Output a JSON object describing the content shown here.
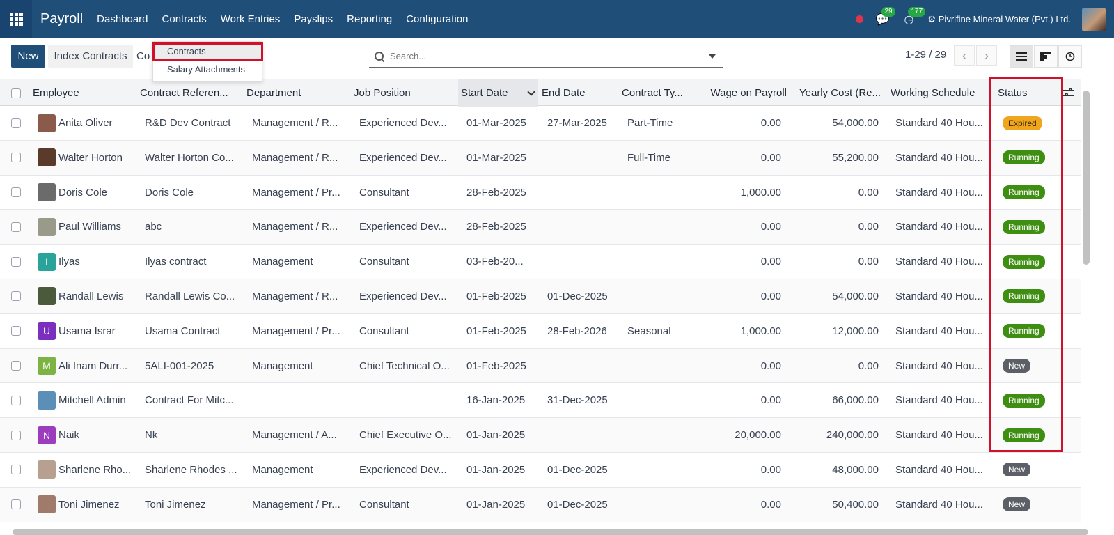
{
  "navbar": {
    "brand": "Payroll",
    "menu": [
      "Dashboard",
      "Contracts",
      "Work Entries",
      "Payslips",
      "Reporting",
      "Configuration"
    ],
    "messages_count": "29",
    "activities_count": "177",
    "company": "Pivrifine Mineral Water (Pvt.) Ltd."
  },
  "control": {
    "new_label": "New",
    "index_label": "Index Contracts",
    "breadcrumb": "Co",
    "dropdown": [
      "Contracts",
      "Salary Attachments"
    ],
    "search_placeholder": "Search...",
    "pager": "1-29 / 29"
  },
  "columns": [
    "Employee",
    "Contract Referen...",
    "Department",
    "Job Position",
    "Start Date",
    "End Date",
    "Contract Ty...",
    "Wage on Payroll",
    "Yearly Cost (Re...",
    "Working Schedule",
    "Status"
  ],
  "rows": [
    {
      "employee": "Anita Oliver",
      "avatar_color": "#8a5a4a",
      "reference": "R&D Dev Contract",
      "department": "Management / R...",
      "job": "Experienced Dev...",
      "start": "01-Mar-2025",
      "end": "27-Mar-2025",
      "type": "Part-Time",
      "wage": "0.00",
      "cost": "54,000.00",
      "schedule": "Standard 40 Hou...",
      "status": "Expired"
    },
    {
      "employee": "Walter Horton",
      "avatar_color": "#5a3a2a",
      "reference": "Walter Horton Co...",
      "department": "Management / R...",
      "job": "Experienced Dev...",
      "start": "01-Mar-2025",
      "end": "",
      "type": "Full-Time",
      "wage": "0.00",
      "cost": "55,200.00",
      "schedule": "Standard 40 Hou...",
      "status": "Running"
    },
    {
      "employee": "Doris Cole",
      "avatar_color": "#6b6b6b",
      "reference": "Doris Cole",
      "department": "Management / Pr...",
      "job": "Consultant",
      "start": "28-Feb-2025",
      "end": "",
      "type": "",
      "wage": "1,000.00",
      "cost": "0.00",
      "schedule": "Standard 40 Hou...",
      "status": "Running"
    },
    {
      "employee": "Paul Williams",
      "avatar_color": "#9a9a8a",
      "reference": "abc",
      "department": "Management / R...",
      "job": "Experienced Dev...",
      "start": "28-Feb-2025",
      "end": "",
      "type": "",
      "wage": "0.00",
      "cost": "0.00",
      "schedule": "Standard 40 Hou...",
      "status": "Running"
    },
    {
      "employee": "Ilyas",
      "avatar_letter": "I",
      "avatar_color": "#2aa39a",
      "reference": "Ilyas contract",
      "department": "Management",
      "job": "Consultant",
      "start": "03-Feb-20...",
      "end": "",
      "type": "",
      "wage": "0.00",
      "cost": "0.00",
      "schedule": "Standard 40 Hou...",
      "status": "Running"
    },
    {
      "employee": "Randall Lewis",
      "avatar_color": "#4a5a3a",
      "reference": "Randall Lewis Co...",
      "department": "Management / R...",
      "job": "Experienced Dev...",
      "start": "01-Feb-2025",
      "end": "01-Dec-2025",
      "type": "",
      "wage": "0.00",
      "cost": "54,000.00",
      "schedule": "Standard 40 Hou...",
      "status": "Running"
    },
    {
      "employee": "Usama Israr",
      "avatar_letter": "U",
      "avatar_color": "#7b2fbe",
      "reference": "Usama Contract",
      "department": "Management / Pr...",
      "job": "Consultant",
      "start": "01-Feb-2025",
      "end": "28-Feb-2026",
      "type": "Seasonal",
      "wage": "1,000.00",
      "cost": "12,000.00",
      "schedule": "Standard 40 Hou...",
      "status": "Running"
    },
    {
      "employee": "Ali Inam Durr...",
      "avatar_letter": "M",
      "avatar_color": "#7cb342",
      "reference": "5ALI-001-2025",
      "department": "Management",
      "job": "Chief Technical O...",
      "start": "01-Feb-2025",
      "end": "",
      "type": "",
      "wage": "0.00",
      "cost": "0.00",
      "schedule": "Standard 40 Hou...",
      "status": "New"
    },
    {
      "employee": "Mitchell Admin",
      "avatar_color": "#5b8fb8",
      "reference": "Contract For Mitc...",
      "department": "",
      "job": "",
      "start": "16-Jan-2025",
      "end": "31-Dec-2025",
      "type": "",
      "wage": "0.00",
      "cost": "66,000.00",
      "schedule": "Standard 40 Hou...",
      "status": "Running"
    },
    {
      "employee": "Naik",
      "avatar_letter": "N",
      "avatar_color": "#9c3dbe",
      "reference": "Nk",
      "department": "Management / A...",
      "job": "Chief Executive O...",
      "start": "01-Jan-2025",
      "end": "",
      "type": "",
      "wage": "20,000.00",
      "cost": "240,000.00",
      "schedule": "Standard 40 Hou...",
      "status": "Running"
    },
    {
      "employee": "Sharlene Rho...",
      "avatar_color": "#b8a090",
      "reference": "Sharlene Rhodes ...",
      "department": "Management",
      "job": "Experienced Dev...",
      "start": "01-Jan-2025",
      "end": "01-Dec-2025",
      "type": "",
      "wage": "0.00",
      "cost": "48,000.00",
      "schedule": "Standard 40 Hou...",
      "status": "New"
    },
    {
      "employee": "Toni Jimenez",
      "avatar_color": "#a07a6a",
      "reference": "Toni Jimenez",
      "department": "Management / Pr...",
      "job": "Consultant",
      "start": "01-Jan-2025",
      "end": "01-Dec-2025",
      "type": "",
      "wage": "0.00",
      "cost": "50,400.00",
      "schedule": "Standard 40 Hou...",
      "status": "New"
    }
  ]
}
